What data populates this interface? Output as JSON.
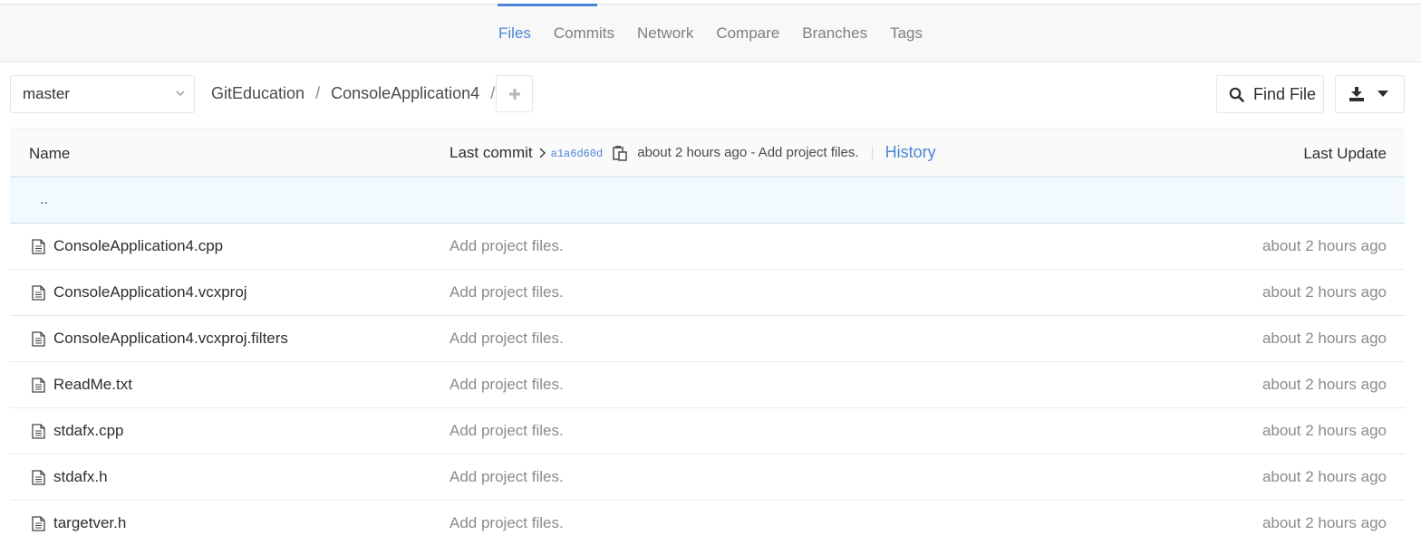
{
  "nav": {
    "tabs": [
      {
        "label": "Files",
        "active": true
      },
      {
        "label": "Commits"
      },
      {
        "label": "Network"
      },
      {
        "label": "Compare"
      },
      {
        "label": "Branches"
      },
      {
        "label": "Tags"
      }
    ]
  },
  "toolbar": {
    "branch": "master",
    "breadcrumb": [
      "GitEducation",
      "ConsoleApplication4"
    ],
    "separator": "/",
    "find_file_label": "Find File",
    "plus_icon": "plus-icon",
    "download_icon": "download-icon"
  },
  "table": {
    "headers": {
      "name": "Name",
      "last_commit": "Last commit",
      "last_update": "Last Update"
    },
    "last_commit": {
      "sha": "a1a6d60d",
      "summary": "about 2 hours ago - Add project files.",
      "history_label": "History"
    },
    "parent_dir": "..",
    "rows": [
      {
        "name": "ConsoleApplication4.cpp",
        "message": "Add project files.",
        "updated": "about 2 hours ago"
      },
      {
        "name": "ConsoleApplication4.vcxproj",
        "message": "Add project files.",
        "updated": "about 2 hours ago"
      },
      {
        "name": "ConsoleApplication4.vcxproj.filters",
        "message": "Add project files.",
        "updated": "about 2 hours ago"
      },
      {
        "name": "ReadMe.txt",
        "message": "Add project files.",
        "updated": "about 2 hours ago"
      },
      {
        "name": "stdafx.cpp",
        "message": "Add project files.",
        "updated": "about 2 hours ago"
      },
      {
        "name": "stdafx.h",
        "message": "Add project files.",
        "updated": "about 2 hours ago"
      },
      {
        "name": "targetver.h",
        "message": "Add project files.",
        "updated": "about 2 hours ago"
      }
    ]
  },
  "colors": {
    "accent": "#4a86d6",
    "header_border": "#c9dfee",
    "parent_row_bg": "#f2f9ff"
  }
}
